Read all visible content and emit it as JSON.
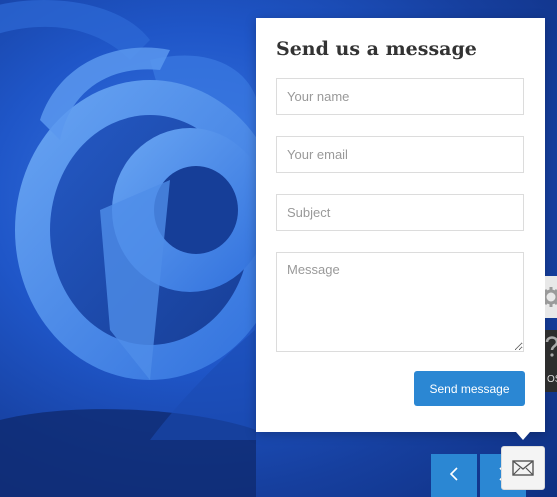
{
  "contact_form": {
    "title": "Send us a message",
    "name_placeholder": "Your name",
    "email_placeholder": "Your email",
    "subject_placeholder": "Subject",
    "message_placeholder": "Message",
    "submit_label": "Send message"
  },
  "side_tabs": {
    "dark_tab_text": "OS"
  },
  "colors": {
    "accent": "#2b87d3",
    "panel_bg": "#ffffff",
    "background": "#1f56c8"
  },
  "icons": {
    "prev": "chevron-left-icon",
    "next": "chevron-right-icon",
    "mail": "envelope-icon",
    "settings": "gear-icon",
    "help": "question-icon"
  }
}
